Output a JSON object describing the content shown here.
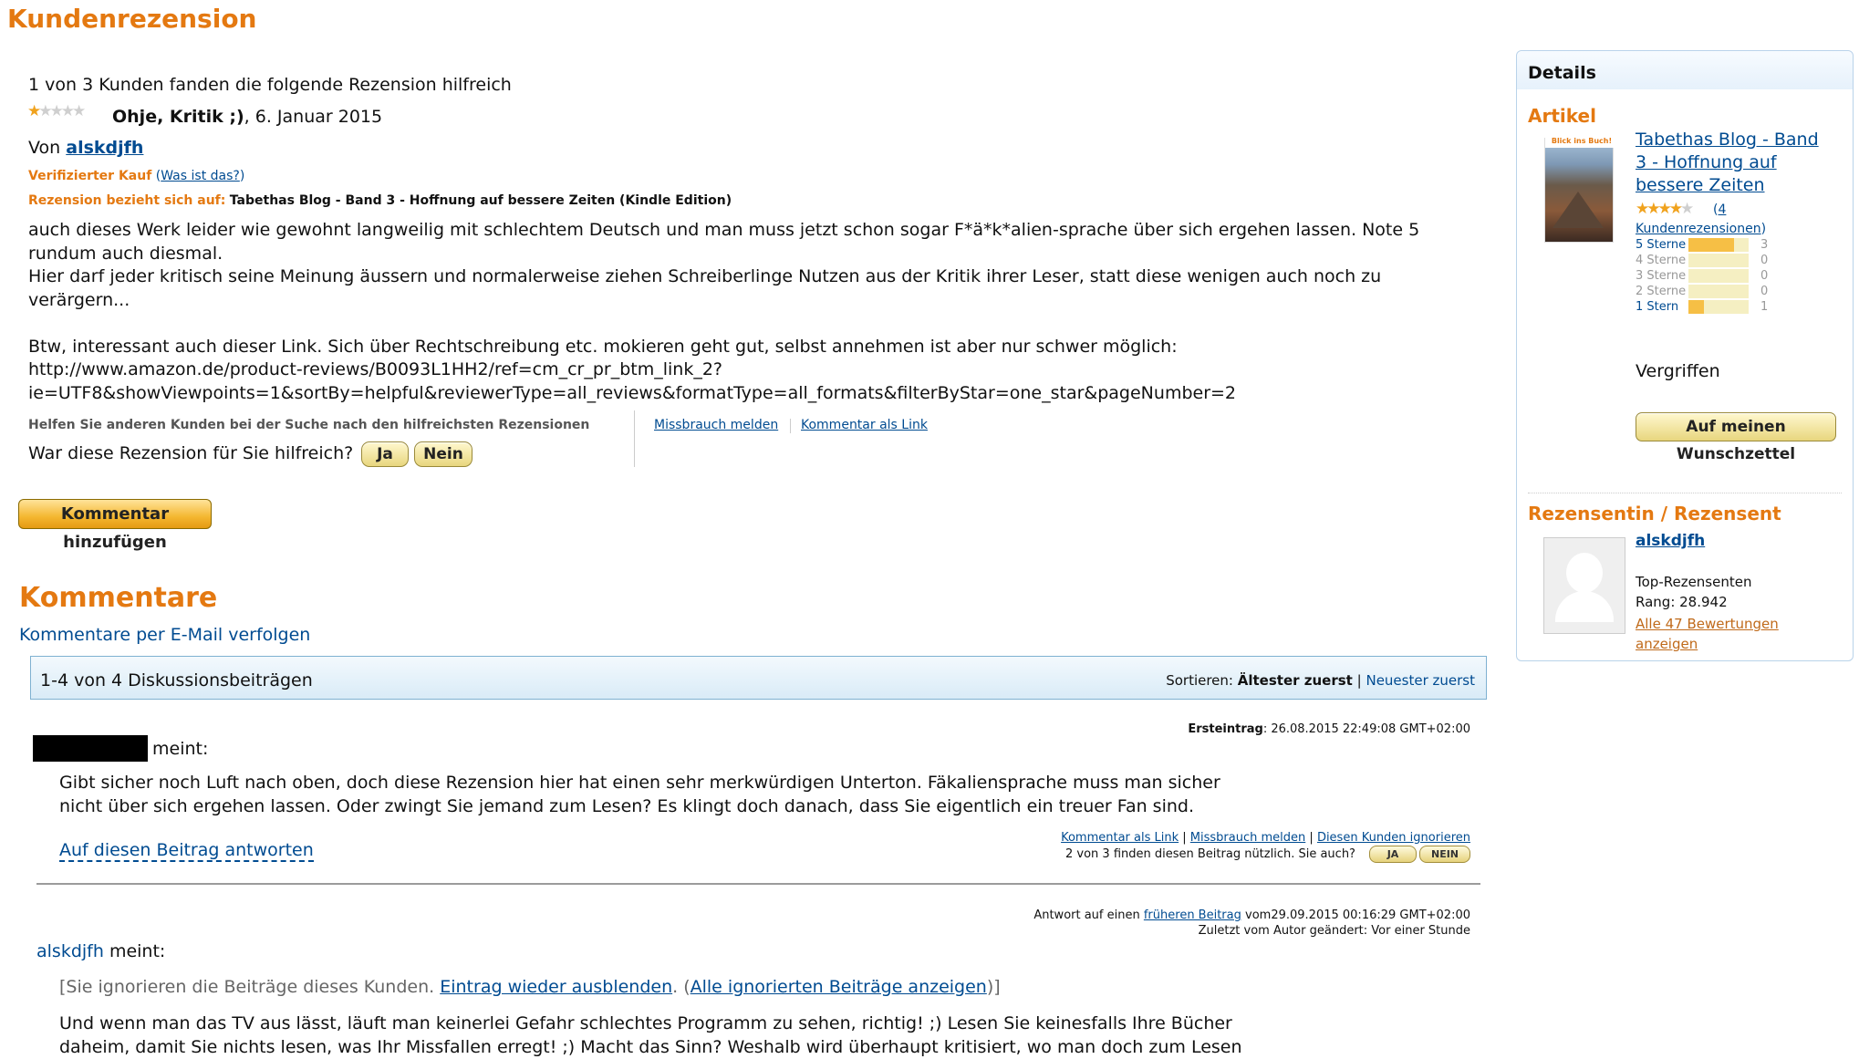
{
  "page": {
    "title": "Kundenrezension"
  },
  "review": {
    "helpful_summary": "1 von 3 Kunden fanden die folgende Rezension hilfreich",
    "rating_stars": 1,
    "rating_max": 5,
    "headline": "Ohje, Kritik ;)",
    "date": ", 6. Januar 2015",
    "by_label": "Von",
    "author": "alskdjfh",
    "verified_label": "Verifizierter Kauf",
    "whats_this": "Was ist das?",
    "relates_label": "Rezension bezieht sich auf:",
    "relates_product": "Tabethas Blog - Band 3 - Hoffnung auf bessere Zeiten (Kindle Edition)",
    "body_lines": [
      "auch dieses Werk leider wie gewohnt langweilig mit schlechtem Deutsch und man muss jetzt schon sogar F*ä*k*alien-sprache über sich ergehen lassen. Note 5",
      "rundum auch diesmal.",
      "Hier darf jeder kritisch seine Meinung äussern und normalerweise ziehen Schreiberlinge Nutzen aus der Kritik ihrer Leser, statt diese wenigen auch noch zu",
      "verärgern...",
      "",
      "Btw, interessant auch dieser Link. Sich über Rechtschreibung etc. mokieren geht gut, selbst annehmen ist aber nur schwer möglich:",
      "http://www.amazon.de/product-reviews/B0093L1HH2/ref=cm_cr_pr_btm_link_2?",
      "ie=UTF8&showViewpoints=1&sortBy=helpful&reviewerType=all_reviews&formatType=all_formats&filterByStar=one_star&pageNumber=2"
    ],
    "help_others_label": "Helfen Sie anderen Kunden bei der Suche nach den hilfreichsten Rezensionen",
    "was_helpful_label": "War diese Rezension für Sie hilfreich?",
    "yes_label": "Ja",
    "no_label": "Nein",
    "report_abuse": "Missbrauch melden",
    "comment_as_link": "Kommentar als Link",
    "add_comment_button": "Kommentar hinzufügen"
  },
  "comments": {
    "title": "Kommentare",
    "follow_email": "Kommentare per E-Mail verfolgen",
    "count_label": "1-4 von 4 Diskussionsbeiträgen",
    "sort_label": "Sortieren:",
    "sort_active": "Ältester zuerst",
    "sort_separator": "|",
    "sort_other": "Neuester zuerst",
    "posts": [
      {
        "first_entry_label": "Ersteintrag",
        "first_entry_value": ": 26.08.2015 22:49:08 GMT+02:00",
        "says": "meint:",
        "body_lines": [
          "Gibt sicher noch Luft nach oben, doch diese Rezension hier hat einen sehr merkwürdigen Unterton. Fäkaliensprache muss man sicher",
          "nicht über sich ergehen lassen. Oder zwingt Sie jemand zum Lesen? Es klingt doch danach, dass Sie eigentlich ein treuer Fan sind."
        ],
        "reply_link": "Auf diesen Beitrag antworten",
        "link_comment": "Kommentar als Link",
        "link_abuse": "Missbrauch melden",
        "link_ignore": "Diesen Kunden ignorieren",
        "helpful_text": "2 von 3 finden diesen Beitrag nützlich. Sie auch?",
        "yes": "JA",
        "no": "NEIN"
      },
      {
        "reply_prefix": "Antwort auf einen",
        "reply_link": "früheren Beitrag",
        "reply_date": "vom29.09.2015 00:16:29 GMT+02:00",
        "edited": "Zuletzt vom Autor geändert: Vor einer Stunde",
        "author": "alskdjfh",
        "says": "meint:",
        "ignored_prefix": "[Sie ignorieren die Beiträge dieses Kunden.",
        "ignored_hide": "Eintrag wieder ausblenden",
        "ignored_mid": ".  (",
        "ignored_show_all": "Alle ignorierten Beiträge anzeigen",
        "ignored_suffix": ")]",
        "body_lines": [
          "Und wenn man das TV aus lässt, läuft man keinerlei Gefahr schlechtes Programm zu sehen, richtig! ;) Lesen Sie keinesfalls Ihre Bücher",
          "daheim, damit Sie nichts lesen, was Ihr Missfallen erregt! ;) Macht das Sinn? Weshalb wird überhaupt kritisiert, wo man doch zum Lesen"
        ]
      }
    ]
  },
  "sidebar": {
    "details_title": "Details",
    "article_title": "Artikel",
    "product_link": "Tabethas Blog - Band 3 - Hoffnung auf bessere Zeiten",
    "product_lines": [
      "Tabethas Blog - Band",
      "3 - Hoffnung auf",
      "bessere Zeiten"
    ],
    "cover_title": "Blick ins Buch!",
    "avg_stars": 4,
    "review_count_prefix": "(",
    "review_count": "4",
    "review_count_label": "Kundenrezensionen",
    "review_count_suffix": ")",
    "histogram": [
      {
        "label": "5 Sterne",
        "count": "3",
        "fraction": 0.75,
        "active": true
      },
      {
        "label": "4 Sterne",
        "count": "0",
        "fraction": 0,
        "active": false
      },
      {
        "label": "3 Sterne",
        "count": "0",
        "fraction": 0,
        "active": false
      },
      {
        "label": "2 Sterne",
        "count": "0",
        "fraction": 0,
        "active": false
      },
      {
        "label": "1 Stern",
        "count": "1",
        "fraction": 0.25,
        "active": true
      }
    ],
    "availability": "Vergriffen",
    "wishlist_button": "Auf meinen Wunschzettel",
    "reviewer_title": "Rezensentin / Rezensent",
    "reviewer_name": "alskdjfh",
    "top_reviewer_label": "Top-Rezensenten",
    "rank": "Rang: 28.942",
    "all_ratings_line1": "Alle 47 Bewertungen",
    "all_ratings_line2": "anzeigen"
  },
  "colors": {
    "accent_orange": "#e47911",
    "link_blue": "#004b91",
    "star_gold": "#f0a21d",
    "bar_fill": "#f6bf45",
    "bar_bg": "#f5efc2"
  }
}
